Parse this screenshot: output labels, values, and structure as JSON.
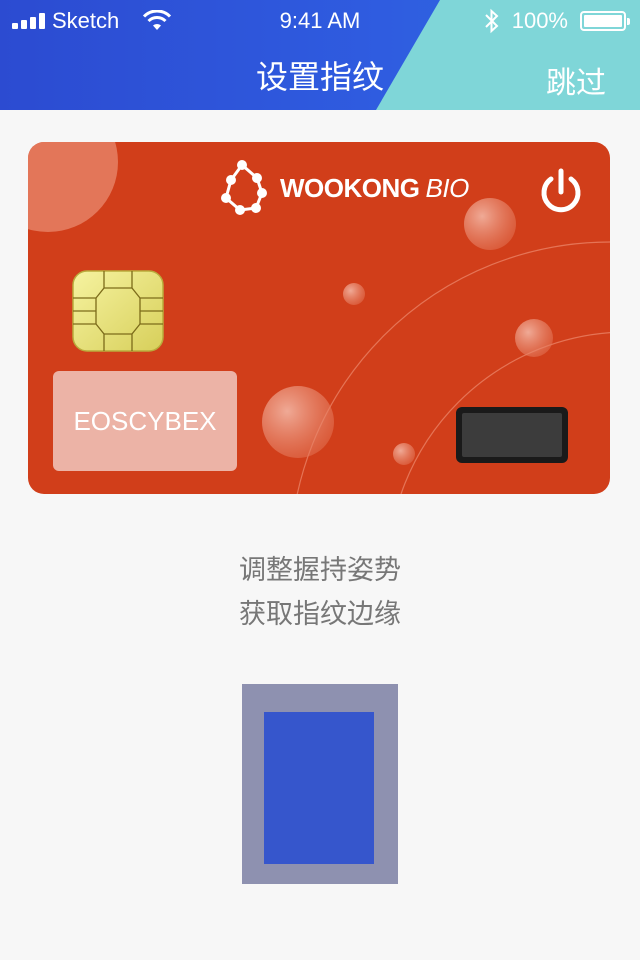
{
  "status_bar": {
    "carrier": "Sketch",
    "time": "9:41 AM",
    "battery_percent": "100%",
    "icons": [
      "signal-icon",
      "wifi-icon",
      "bluetooth-icon",
      "battery-icon"
    ]
  },
  "nav": {
    "title": "设置指纹",
    "skip_label": "跳过"
  },
  "card": {
    "brand_name": "WOOKONG",
    "brand_suffix": "BIO",
    "owner_label": "EOSCYBEX",
    "icons": [
      "wookong-logo-icon",
      "power-icon",
      "chip-icon",
      "fingerprint-sensor-icon"
    ]
  },
  "instructions": {
    "line1": "调整握持姿势",
    "line2": "获取指纹边缘"
  },
  "colors": {
    "header_blue": "#2c4bd1",
    "header_teal": "#7fd6d8",
    "card_orange": "#d13e1a",
    "fingerprint_blue": "#3656cc",
    "fingerprint_frame": "#8e91b0"
  }
}
